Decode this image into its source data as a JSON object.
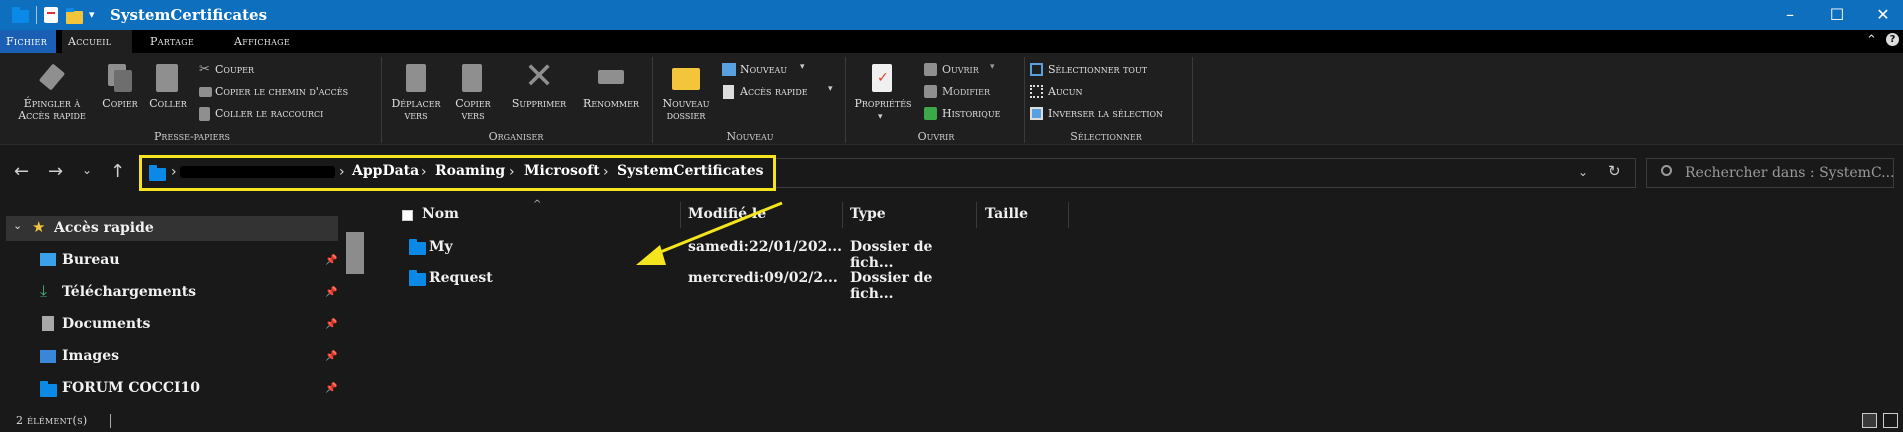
{
  "window": {
    "title": "SystemCertificates",
    "controls": {
      "minimize": "–",
      "maximize": "☐",
      "close": "✕"
    }
  },
  "tabs": [
    {
      "label": "Fichier"
    },
    {
      "label": "Accueil"
    },
    {
      "label": "Partage"
    },
    {
      "label": "Affichage"
    }
  ],
  "ribbon": {
    "clipboard": {
      "pin_line1": "Épingler à",
      "pin_line2": "Accès rapide",
      "copy": "Copier",
      "paste": "Coller",
      "cut": "Couper",
      "copy_path": "Copier le chemin d'accès",
      "paste_shortcut": "Coller le raccourci",
      "group": "Presse-papiers"
    },
    "organize": {
      "move_line1": "Déplacer",
      "move_line2": "vers",
      "copyto_line1": "Copier",
      "copyto_line2": "vers",
      "delete": "Supprimer",
      "rename": "Renommer",
      "group": "Organiser"
    },
    "new": {
      "folder_line1": "Nouveau",
      "folder_line2": "dossier",
      "new_item": "Nouveau",
      "easy_access": "Accès rapide",
      "group": "Nouveau"
    },
    "open": {
      "properties": "Propriétés",
      "open": "Ouvrir",
      "edit": "Modifier",
      "history": "Historique",
      "group": "Ouvrir"
    },
    "select": {
      "select_all": "Sélectionner tout",
      "select_none": "Aucun",
      "invert": "Inverser la sélection",
      "group": "Sélectionner"
    }
  },
  "address": {
    "crumbs": [
      "AppData",
      "Roaming",
      "Microsoft",
      "SystemCertificates"
    ]
  },
  "search": {
    "placeholder": "Rechercher dans : SystemC..."
  },
  "navpane": {
    "quick_access": "Accès rapide",
    "items": [
      {
        "label": "Bureau"
      },
      {
        "label": "Téléchargements"
      },
      {
        "label": "Documents"
      },
      {
        "label": "Images"
      },
      {
        "label": "FORUM COCCI10"
      }
    ]
  },
  "columns": {
    "name": "Nom",
    "modified": "Modifié le",
    "type": "Type",
    "size": "Taille"
  },
  "files": [
    {
      "name": "My",
      "modified": "samedi:22/01/202...",
      "type": "Dossier de fich..."
    },
    {
      "name": "Request",
      "modified": "mercredi:09/02/2...",
      "type": "Dossier de fich..."
    }
  ],
  "status": {
    "count": "2 élément(s)"
  },
  "colors": {
    "titlebar": "#0f6fbf",
    "highlight": "#f5e51e",
    "folder": "#0a8ae6",
    "background": "#191919"
  }
}
